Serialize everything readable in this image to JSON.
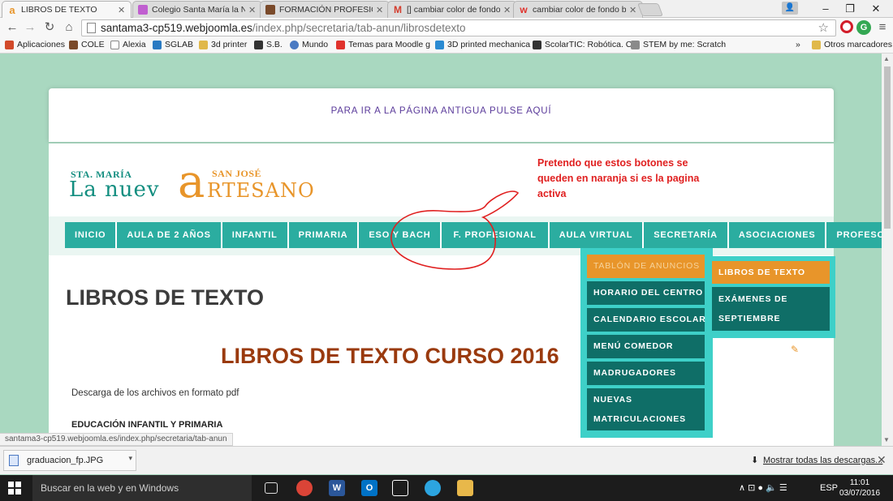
{
  "browser": {
    "tabs": [
      {
        "title": "LIBROS DE TEXTO",
        "favicon": "a",
        "favicon_color": "#e8952a",
        "active": true
      },
      {
        "title": "Colegio Santa María la Nu",
        "favicon": "",
        "favicon_color": "#c05fd0",
        "active": false
      },
      {
        "title": "FORMACIÓN PROFESION",
        "favicon": "",
        "favicon_color": "#7a4a2a",
        "active": false
      },
      {
        "title": "[] cambiar color de fondo",
        "favicon": "M",
        "favicon_color": "#d33b2c",
        "active": false
      },
      {
        "title": "cambiar color de fondo b",
        "favicon": "w",
        "favicon_color": "#e0322c",
        "active": false
      }
    ],
    "window_controls": {
      "minimize": "–",
      "maximize": "❐",
      "close": "✕"
    },
    "address": {
      "domain": "santama3-cp519.webjoomla.es",
      "path": "/index.php/secretaria/tab-anun/librosdetexto"
    },
    "bookmarks": [
      {
        "label": "Aplicaciones",
        "color": "#d24a2a"
      },
      {
        "label": "COLE",
        "color": "#7a4a2a"
      },
      {
        "label": "Alexia",
        "color": "#ffffff"
      },
      {
        "label": "SGLAB",
        "color": "#2a7ac2"
      },
      {
        "label": "3d printer",
        "color": "#e0b84a"
      },
      {
        "label": "S.B.",
        "color": "#333333"
      },
      {
        "label": "Mundo",
        "color": "#4a7ac2"
      },
      {
        "label": "Temas para Moodle g",
        "color": "#e0322c"
      },
      {
        "label": "3D printed mechanica",
        "color": "#2a8ad2"
      },
      {
        "label": "ScolarTIC: Robótica. C",
        "color": "#333333"
      },
      {
        "label": "STEM by me: Scratch",
        "color": "#8a8a8a"
      }
    ],
    "bookmarks_more": "»",
    "other_bookmarks": "Otros marcadores"
  },
  "page": {
    "notice": "PARA IR A LA PÁGINA ANTIGUA PULSE AQUÍ",
    "logo": {
      "sta_maria": "STA. MARÍA",
      "san_jose": "SAN JOSÉ",
      "la_nuev": "La nuev",
      "a": "a",
      "rtesano": "RTESANO"
    },
    "annotation": "Pretendo que estos botones se queden en naranja si es la pagina activa",
    "nav": [
      "INICIO",
      "AULA DE 2 AÑOS",
      "INFANTIL",
      "PRIMARIA",
      "ESO Y BACH",
      "F. PROFESIONAL",
      "AULA VIRTUAL",
      "SECRETARÍA",
      "ASOCIACIONES",
      "PROFESOR"
    ],
    "submenu": [
      "TABLÓN DE ANUNCIOS",
      "HORARIO DEL CENTRO",
      "CALENDARIO ESCOLAR",
      "MENÚ COMEDOR",
      "MADRUGADORES",
      "NUEVAS MATRICULACIONES"
    ],
    "submenu2": [
      "LIBROS DE TEXTO",
      "EXÁMENES DE SEPTIEMBRE"
    ],
    "heading": "LIBROS DE TEXTO",
    "subheading": "LIBROS DE TEXTO CURSO 2016",
    "description": "Descarga de los archivos en formato pdf",
    "section": "EDUCACIÓN INFANTIL Y PRIMARIA",
    "hover_url": "santama3-cp519.webjoomla.es/index.php/secretaria/tab-anun"
  },
  "downloads": {
    "file": "graduacion_fp.JPG",
    "show_all": "Mostrar todas las descargas..."
  },
  "taskbar": {
    "search": "Buscar en la web y en Windows",
    "lang": "ESP",
    "time": "11:01",
    "date": "03/07/2016"
  },
  "colors": {
    "accent_teal": "#2bada0",
    "accent_orange": "#e8952a",
    "annotation_red": "#e02020"
  }
}
